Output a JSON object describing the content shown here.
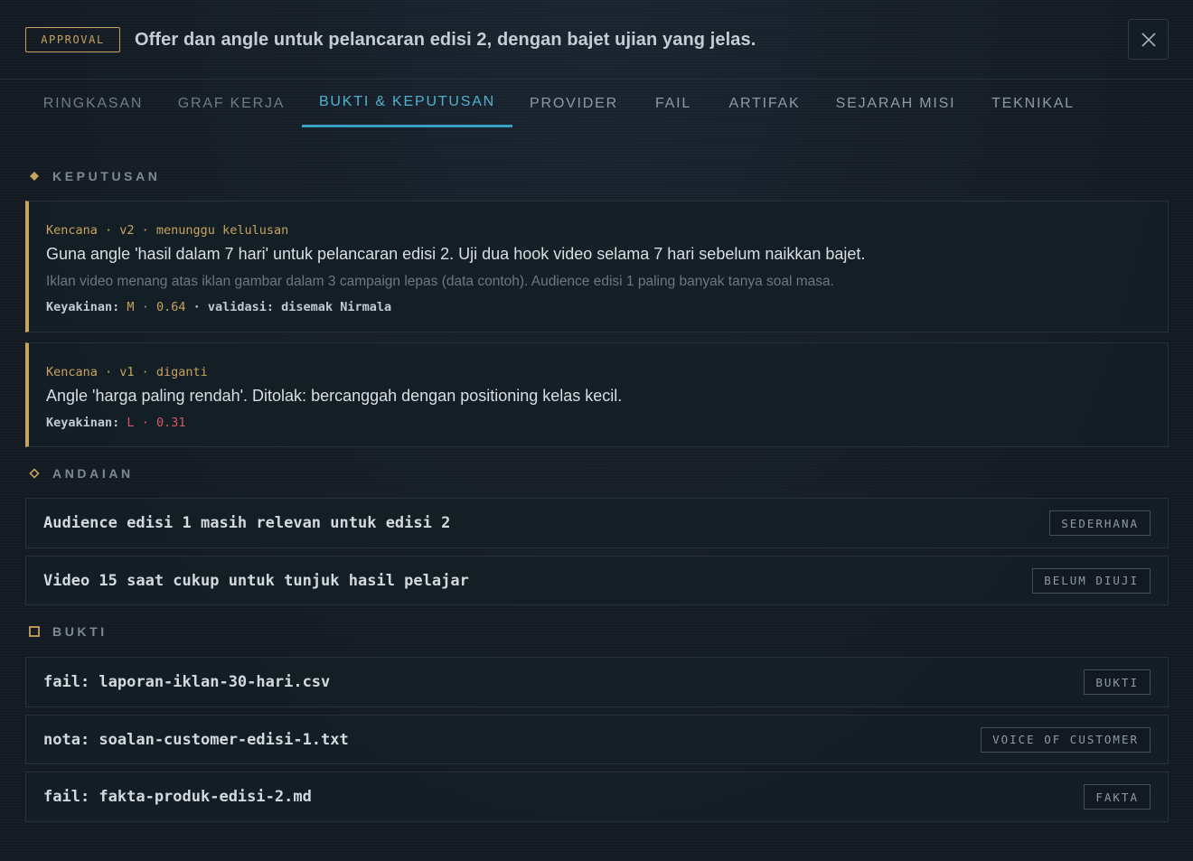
{
  "header": {
    "badge": "APPROVAL",
    "title": "Offer dan angle untuk pelancaran edisi 2, dengan bajet ujian yang jelas.",
    "close_icon": "close-icon"
  },
  "tabs": [
    {
      "label": "RINGKASAN"
    },
    {
      "label": "GRAF KERJA"
    },
    {
      "label": "BUKTI & KEPUTUSAN",
      "active": true
    },
    {
      "label": "PROVIDER"
    },
    {
      "label": "FAIL"
    },
    {
      "label": "ARTIFAK"
    },
    {
      "label": "SEJARAH MISI"
    },
    {
      "label": "TEKNIKAL"
    }
  ],
  "sections": {
    "keputusan": {
      "title": "KEPUTUSAN",
      "icon": "diamond-filled-icon"
    },
    "andaian": {
      "title": "ANDAIAN",
      "icon": "diamond-outline-icon"
    },
    "bukti": {
      "title": "BUKTI",
      "icon": "square-outline-icon"
    }
  },
  "decisions": [
    {
      "meta": "Kencana · v2 · menunggu kelulusan",
      "text": "Guna angle 'hasil dalam 7 hari' untuk pelancaran edisi 2. Uji dua hook video selama 7 hari sebelum naikkan bajet.",
      "sub": "Iklan video menang atas iklan gambar dalam 3 campaign lepas (data contoh). Audience edisi 1 paling banyak tanya soal masa.",
      "conf_label": "Keyakinan:",
      "conf_level": "M",
      "conf_sep": "·",
      "conf_value": "0.64",
      "conf_extra": "· validasi: disemak Nirmala"
    },
    {
      "meta": "Kencana · v1 · diganti",
      "text": "Angle 'harga paling rendah'. Ditolak: bercanggah dengan positioning kelas kecil.",
      "conf_label": "Keyakinan:",
      "conf_level": "L",
      "conf_sep": "·",
      "conf_value": "0.31"
    }
  ],
  "assumptions": [
    {
      "text": "Audience edisi 1 masih relevan untuk edisi 2",
      "tag": "SEDERHANA"
    },
    {
      "text": "Video 15 saat cukup untuk tunjuk hasil pelajar",
      "tag": "BELUM DIUJI"
    }
  ],
  "evidence": [
    {
      "text": "fail: laporan-iklan-30-hari.csv",
      "tag": "BUKTI"
    },
    {
      "text": "nota: soalan-customer-edisi-1.txt",
      "tag": "VOICE OF CUSTOMER"
    },
    {
      "text": "fail: fakta-produk-edisi-2.md",
      "tag": "FAKTA"
    }
  ],
  "colors": {
    "accent_gold": "#c7a25e",
    "accent_cyan": "#4fb3cf",
    "low_red": "#d15a67",
    "background": "#141c24"
  }
}
